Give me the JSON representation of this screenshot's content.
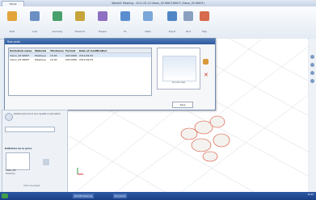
{
  "window": {
    "title": "WorkNC Meshing - 2011.02.15.Vision_05.WNCF.WNCF (Vision_05.WNCF)",
    "tab": "Home"
  },
  "ribbon": {
    "buttons": [
      {
        "label": "Parts",
        "icon": "parts-icon",
        "color": "#e3a43b"
      },
      {
        "label": "Load",
        "icon": "load-icon",
        "color": "#6b8fc3"
      },
      {
        "label": "Geometry",
        "icon": "geometry-icon",
        "color": "#4aa06c"
      },
      {
        "label": "Transform",
        "icon": "transform-icon",
        "color": "#c6a43b"
      },
      {
        "label": "Prepare",
        "icon": "prepare-icon",
        "color": "#8f6fc2"
      },
      {
        "label": "Fix",
        "icon": "fix-icon",
        "color": "#5a8ecf"
      },
      {
        "label": "Utility",
        "icon": "utility-icon",
        "color": "#7aa6d9"
      },
      {
        "label": "Export",
        "icon": "export-icon",
        "color": "#4f86c6"
      },
      {
        "label": "Print",
        "icon": "print-icon",
        "color": "#8aa0bf"
      },
      {
        "label": "Help",
        "icon": "help-icon",
        "color": "#d66b4f"
      }
    ]
  },
  "dialog": {
    "title": "Raw parts",
    "columns": [
      "Part/stock name",
      "Material",
      "Thickness",
      "Format",
      "Date of modification"
    ],
    "rows": [
      [
        "Vision_05.WNCF",
        "Plastique",
        "10.00",
        "200.0000",
        "2011/02/15"
      ],
      [
        "Vision_05.WNCF",
        "Plastique",
        "10.00",
        "200.0000",
        "2011/02/15"
      ]
    ],
    "preview_label": "Current view",
    "ok_label": "Save"
  },
  "sidepanel": {
    "info": "Positionnez le brut pour ajuster la simulation",
    "section_title": "Définition de la pièce",
    "part_label": "Vision_05",
    "material": "Plastique",
    "footer": "Choix du projet"
  },
  "taskbar": {
    "items": [
      "WorkNC Meshing",
      "Document"
    ],
    "clock": "10:45"
  }
}
